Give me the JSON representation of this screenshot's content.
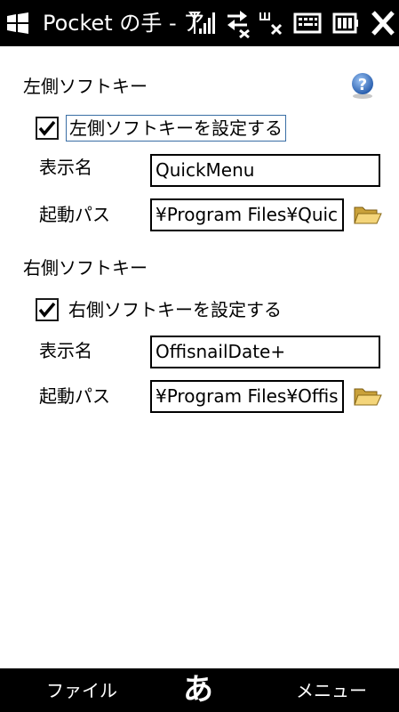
{
  "titlebar": {
    "title": "Pocket の手 - ア",
    "icons": [
      "windows-start-icon",
      "signal-icon",
      "data-connection-icon",
      "wifi-off-icon",
      "keyboard-icon",
      "battery-icon",
      "close-icon"
    ]
  },
  "left_softkey": {
    "heading": "左側ソフトキー",
    "enable_label": "左側ソフトキーを設定する",
    "enabled": true,
    "display_name_label": "表示名",
    "display_name_value": "QuickMenu",
    "path_label": "起動パス",
    "path_value": "¥Program Files¥Quic"
  },
  "right_softkey": {
    "heading": "右側ソフトキー",
    "enable_label": "右側ソフトキーを設定する",
    "enabled": true,
    "display_name_label": "表示名",
    "display_name_value": "OffisnailDate+",
    "path_label": "起動パス",
    "path_value": "¥Program Files¥Offis"
  },
  "softbar": {
    "left": "ファイル",
    "ime": "あ",
    "right": "メニュー"
  },
  "colors": {
    "bar_background": "#000000",
    "page_background": "#ffffff",
    "focus_border": "#3a6ea5",
    "folder": "#e8c060",
    "help": "#2a63b8"
  }
}
